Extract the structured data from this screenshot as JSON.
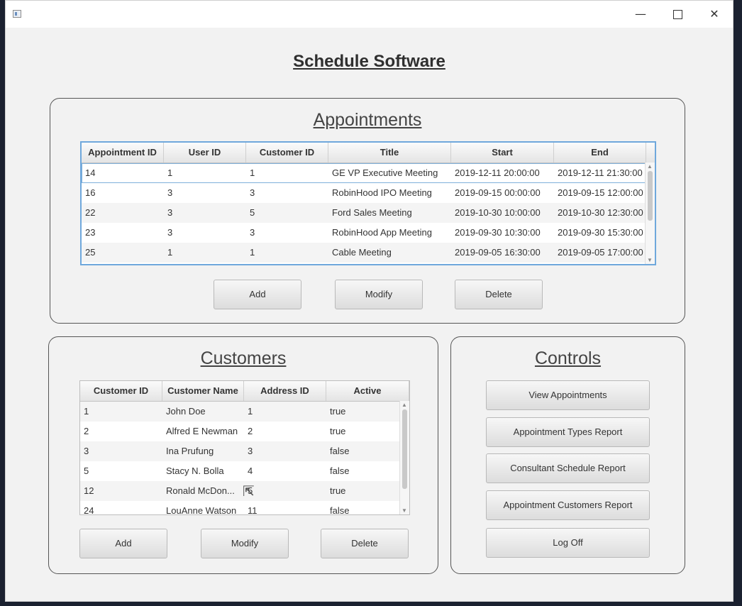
{
  "app": {
    "title": "Schedule Software"
  },
  "window_controls": {
    "minimize": "—",
    "close": "✕"
  },
  "appointments": {
    "title": "Appointments",
    "columns": [
      "Appointment ID",
      "User ID",
      "Customer ID",
      "Title",
      "Start",
      "End"
    ],
    "rows": [
      [
        "14",
        "1",
        "1",
        "GE VP Executive Meeting",
        "2019-12-11 20:00:00",
        "2019-12-11 21:30:00"
      ],
      [
        "16",
        "3",
        "3",
        "RobinHood IPO Meeting",
        "2019-09-15 00:00:00",
        "2019-09-15 12:00:00"
      ],
      [
        "22",
        "3",
        "5",
        "Ford Sales Meeting",
        "2019-10-30 10:00:00",
        "2019-10-30 12:30:00"
      ],
      [
        "23",
        "3",
        "3",
        "RobinHood App Meeting",
        "2019-09-30 10:30:00",
        "2019-09-30 15:30:00"
      ],
      [
        "25",
        "1",
        "1",
        "Cable Meeting",
        "2019-09-05 16:30:00",
        "2019-09-05 17:00:00"
      ]
    ],
    "buttons": {
      "add": "Add",
      "modify": "Modify",
      "delete": "Delete"
    }
  },
  "customers": {
    "title": "Customers",
    "columns": [
      "Customer ID",
      "Customer Name",
      "Address ID",
      "Active"
    ],
    "rows": [
      [
        "1",
        "John Doe",
        "1",
        "true"
      ],
      [
        "2",
        "Alfred E Newman",
        "2",
        "true"
      ],
      [
        "3",
        "Ina Prufung",
        "3",
        "false"
      ],
      [
        "5",
        "Stacy N. Bolla",
        "4",
        "false"
      ],
      [
        "12",
        "Ronald McDon...",
        "5",
        "true"
      ],
      [
        "24",
        "LouAnne Watson",
        "11",
        "false"
      ]
    ],
    "buttons": {
      "add": "Add",
      "modify": "Modify",
      "delete": "Delete"
    }
  },
  "controls": {
    "title": "Controls",
    "buttons": {
      "view_appointments": "View Appointments",
      "appointment_types_report": "Appointment Types Report",
      "consultant_schedule_report": "Consultant Schedule Report",
      "appointment_customers_report": "Appointment Customers Report",
      "log_off": "Log Off"
    }
  }
}
